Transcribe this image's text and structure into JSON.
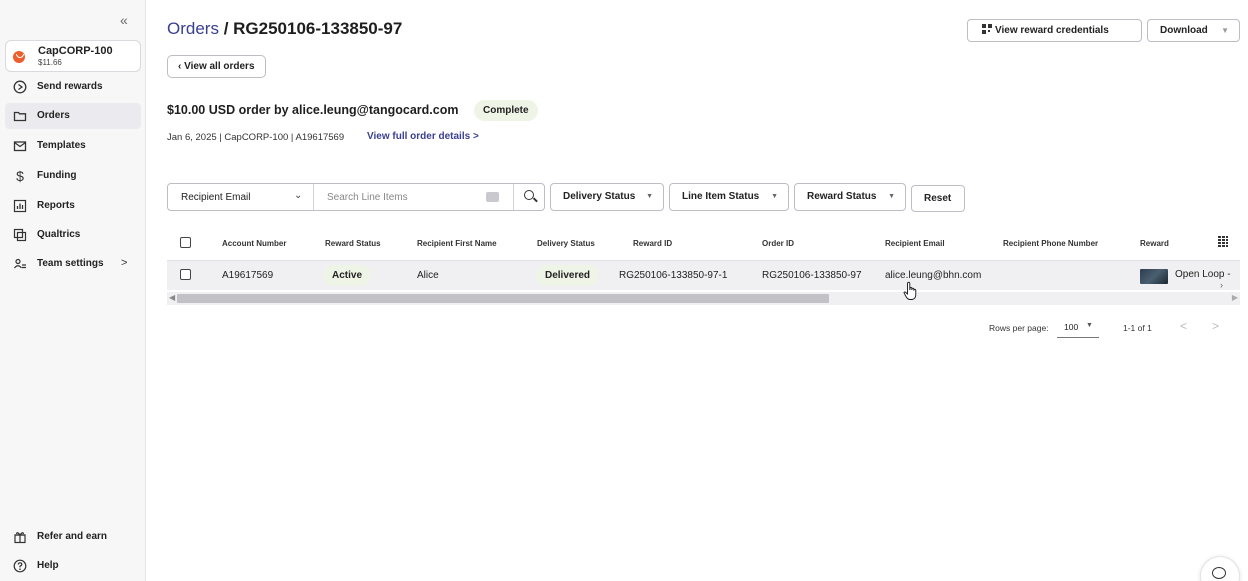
{
  "sidebar": {
    "collapse_glyph": "«",
    "account": {
      "name": "CapCORP-100",
      "balance": "$11.66",
      "icon": "account-logo-icon",
      "color": "#ec5f2c"
    },
    "items": [
      {
        "label": "Send rewards",
        "icon": "send-arrow-icon"
      },
      {
        "label": "Orders",
        "icon": "folder-icon",
        "active": true
      },
      {
        "label": "Templates",
        "icon": "mail-icon"
      },
      {
        "label": "Funding",
        "icon": "dollar-icon"
      },
      {
        "label": "Reports",
        "icon": "chart-icon"
      },
      {
        "label": "Qualtrics",
        "icon": "qualtrics-icon"
      },
      {
        "label": "Team settings",
        "icon": "team-icon",
        "chevron": ">"
      }
    ],
    "footer": [
      {
        "label": "Refer and earn",
        "icon": "gift-icon"
      },
      {
        "label": "Help",
        "icon": "help-icon"
      }
    ]
  },
  "header": {
    "breadcrumb_link": "Orders",
    "breadcrumb_sep": " / ",
    "order_id": "RG250106-133850-97",
    "back_label": "View all orders",
    "creds_label": "View reward credentials",
    "download_label": "Download",
    "accent": "#3a3f8f"
  },
  "order": {
    "headline": "$10.00 USD order by alice.leung@tangocard.com",
    "status": "Complete",
    "meta": "Jan 6, 2025 | CapCORP-100 | A19617569",
    "details_link": "View full order details >"
  },
  "filters": {
    "field_select": "Recipient Email",
    "search_placeholder": "Search Line Items",
    "delivery_status": "Delivery Status",
    "line_item_status": "Line Item Status",
    "reward_status": "Reward Status",
    "reset": "Reset"
  },
  "table": {
    "columns": [
      "Account Number",
      "Reward Status",
      "Recipient First Name",
      "Delivery Status",
      "Reward ID",
      "Order ID",
      "Recipient Email",
      "Recipient Phone Number",
      "Reward"
    ],
    "rows": [
      {
        "account_number": "A19617569",
        "reward_status": "Active",
        "first_name": "Alice",
        "delivery_status": "Delivered",
        "reward_id": "RG250106-133850-97-1",
        "order_id": "RG250106-133850-97",
        "email": "alice.leung@bhn.com",
        "phone": "",
        "reward": "Open Loop -"
      }
    ]
  },
  "pagination": {
    "rows_label": "Rows per page:",
    "rows_value": "100",
    "range": "1-1 of 1",
    "prev": "<",
    "next": ">"
  }
}
